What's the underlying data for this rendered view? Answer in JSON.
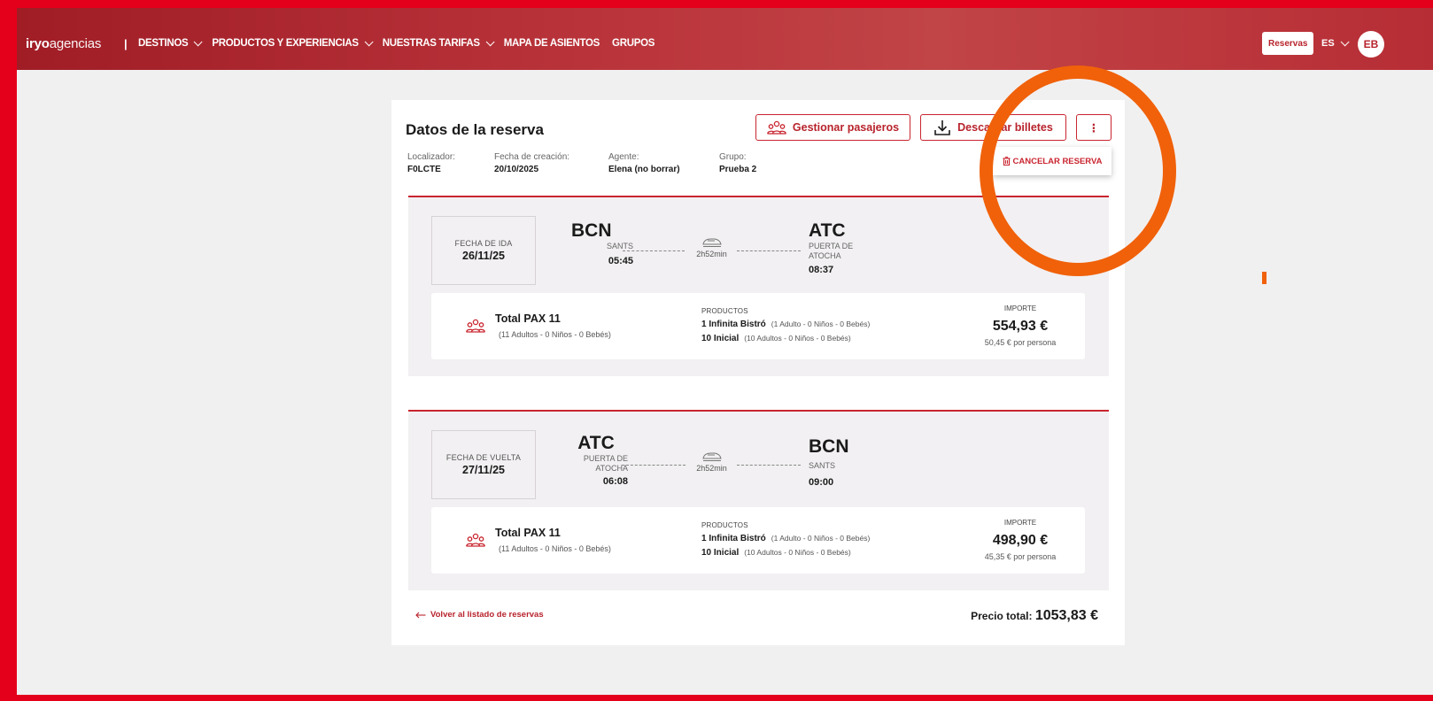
{
  "nav": {
    "logo_bold": "iryo",
    "logo_light": "agencias",
    "separator": "|",
    "links": [
      "DESTINOS",
      "PRODUCTOS Y EXPERIENCIAS",
      "NUESTRAS TARIFAS",
      "MAPA DE ASIENTOS",
      "GRUPOS"
    ],
    "reservas": "Reservas",
    "lang": "ES",
    "avatar": "EB"
  },
  "reservation": {
    "title": "Datos de la reserva",
    "manage_label": "Gestionar pasajeros",
    "download_label": "Descargar billetes",
    "more_label": "⋮",
    "cancel_label": "CANCELAR RESERVA",
    "meta": [
      {
        "label": "Localizador:",
        "value": "F0LCTE"
      },
      {
        "label": "Fecha de creación:",
        "value": "20/10/2025"
      },
      {
        "label": "Agente:",
        "value": "Elena (no borrar)"
      },
      {
        "label": "Grupo:",
        "value": "Prueba 2"
      }
    ]
  },
  "legs": [
    {
      "date_label": "FECHA DE IDA",
      "date": "26/11/25",
      "origin": {
        "code": "BCN",
        "name": "SANTS",
        "time": "05:45"
      },
      "duration": "2h52min",
      "dest": {
        "code": "ATC",
        "name": "PUERTA DE ATOCHA",
        "time": "08:37"
      },
      "pax_title": "Total PAX 11",
      "pax_sub": "(11 Adultos - 0 Niños - 0 Bebés)",
      "products_label": "PRODUCTOS",
      "products": [
        {
          "name": "1 Infinita Bistró",
          "detail": "(1 Adulto - 0 Niños - 0 Bebés)"
        },
        {
          "name": "10 Inicial",
          "detail": "(10 Adultos - 0 Niños - 0 Bebés)"
        }
      ],
      "importe_label": "IMPORTE",
      "importe": "554,93 €",
      "per_person": "50,45 € por persona"
    },
    {
      "date_label": "FECHA DE VUELTA",
      "date": "27/11/25",
      "origin": {
        "code": "ATC",
        "name": "PUERTA DE ATOCHA",
        "time": "06:08"
      },
      "duration": "2h52min",
      "dest": {
        "code": "BCN",
        "name": "SANTS",
        "time": "09:00"
      },
      "pax_title": "Total PAX 11",
      "pax_sub": "(11 Adultos - 0 Niños - 0 Bebés)",
      "products_label": "PRODUCTOS",
      "products": [
        {
          "name": "1 Infinita Bistró",
          "detail": "(1 Adulto - 0 Niños - 0 Bebés)"
        },
        {
          "name": "10 Inicial",
          "detail": "(10 Adultos - 0 Niños - 0 Bebés)"
        }
      ],
      "importe_label": "IMPORTE",
      "importe": "498,90 €",
      "per_person": "45,35 € por persona"
    }
  ],
  "footer": {
    "back_label": "Volver al listado de reservas",
    "total_label": "Precio total:",
    "total_value": "1053,83 €"
  },
  "colors": {
    "brand": "#b8232c",
    "highlight": "#f0610a"
  }
}
